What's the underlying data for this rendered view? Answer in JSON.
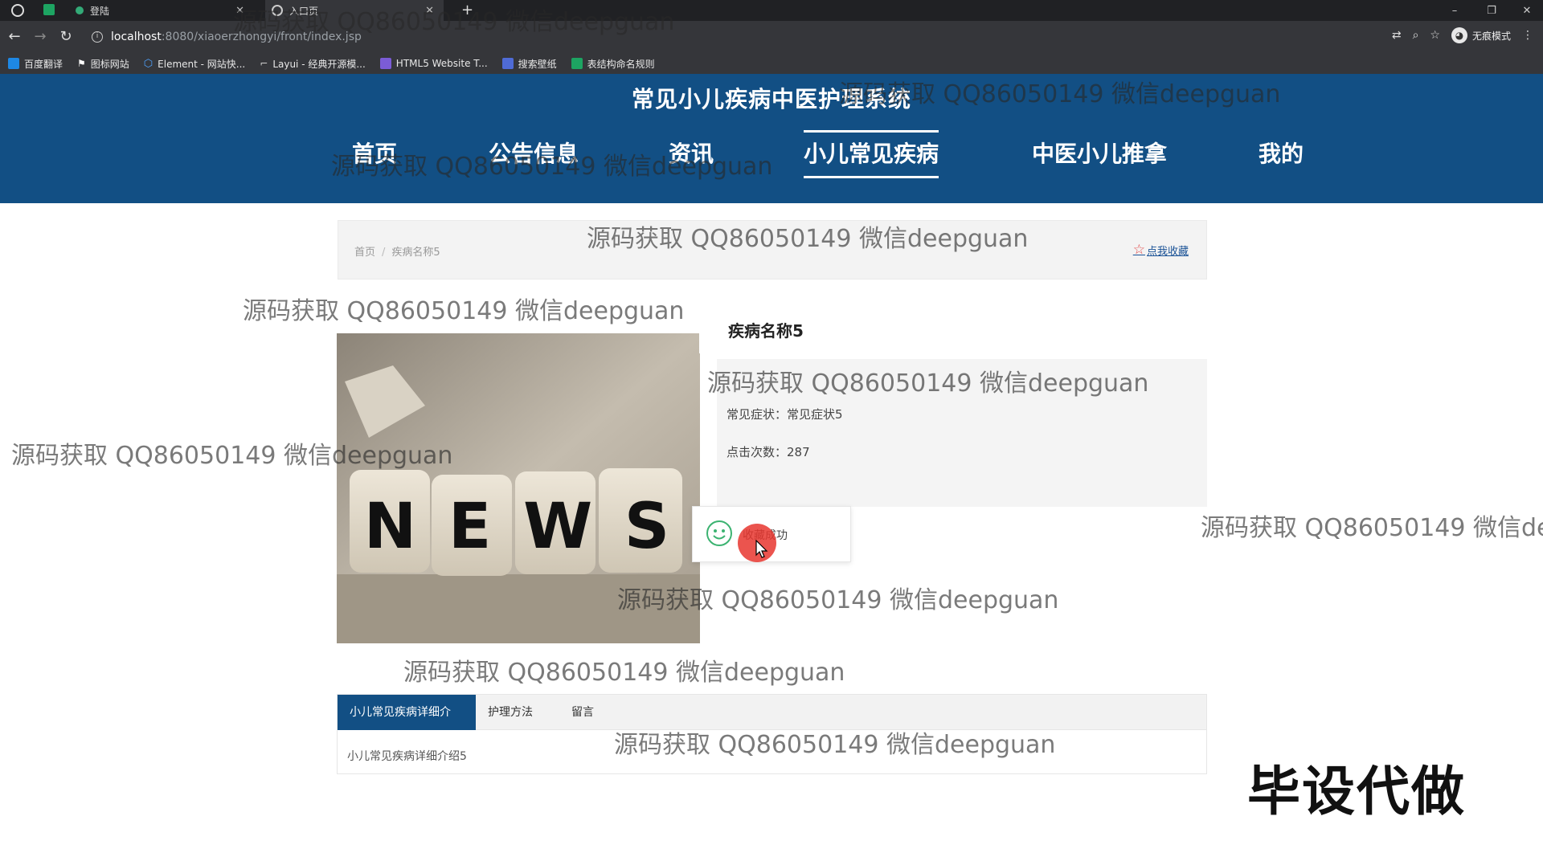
{
  "browser": {
    "tabs": [
      {
        "title": "登陆"
      },
      {
        "title": "入口页"
      }
    ],
    "new_tab": "+",
    "url_host": "localhost",
    "url_path": ":8080/xiaoerzhongyi/front/index.jsp",
    "profile_label": "无痕模式",
    "bookmarks": [
      {
        "label": "百度翻译",
        "color": "#1e88e5"
      },
      {
        "label": "图标网站",
        "color": "#ffffff"
      },
      {
        "label": "Element - 网站快...",
        "color": "#4fa3ff"
      },
      {
        "label": "Layui - 经典开源模...",
        "color": "#cccccc"
      },
      {
        "label": "HTML5 Website T...",
        "color": "#7b5cd6"
      },
      {
        "label": "搜索壁纸",
        "color": "#4f6bd6"
      },
      {
        "label": "表结构命名规则",
        "color": "#1da462"
      }
    ]
  },
  "site": {
    "title": "常见小儿疾病中医护理系统",
    "nav": [
      {
        "label": "首页"
      },
      {
        "label": "公告信息"
      },
      {
        "label": "资讯"
      },
      {
        "label": "小儿常见疾病"
      },
      {
        "label": "中医小儿推拿"
      },
      {
        "label": "我的"
      }
    ]
  },
  "breadcrumb": {
    "home": "首页",
    "sep": "/",
    "current": "疾病名称5"
  },
  "favorite_link": "点我收藏",
  "detail": {
    "name": "疾病名称5",
    "symptom_label": "常见症状：",
    "symptom_value": "常见症状5",
    "clicks_label": "点击次数：",
    "clicks_value": "287",
    "image_word": "NEWS"
  },
  "toast": {
    "message": "收藏成功"
  },
  "tabs": [
    {
      "label": "小儿常见疾病详细介"
    },
    {
      "label": "护理方法"
    },
    {
      "label": "留言"
    }
  ],
  "tab_content": "小儿常见疾病详细介绍5",
  "promo": "毕设代做",
  "watermark": "源码获取 QQ86050149 微信deepguan",
  "colors": {
    "header_blue": "#124f84",
    "accent_red": "#e8362f"
  }
}
